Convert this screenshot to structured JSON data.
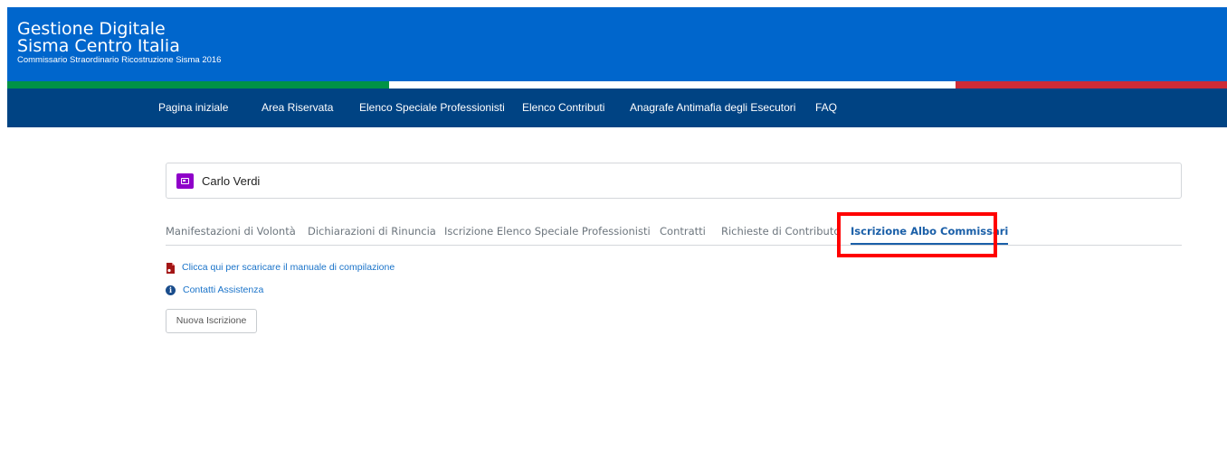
{
  "header": {
    "title_line1": "Gestione Digitale",
    "title_line2": "Sisma Centro Italia",
    "subtitle": "Commissario Straordinario Ricostruzione Sisma 2016",
    "background": "#0066cc"
  },
  "tricolor": {
    "green": "#009246",
    "white": "#ffffff",
    "red": "#ce2b37"
  },
  "nav": {
    "items": [
      {
        "label": "Pagina iniziale"
      },
      {
        "label": "Area Riservata"
      },
      {
        "label": "Elenco Speciale Professionisti"
      },
      {
        "label": "Elenco Contributi"
      },
      {
        "label": "Anagrafe Antimafia degli Esecutori"
      },
      {
        "label": "FAQ"
      }
    ]
  },
  "user": {
    "name": "Carlo Verdi",
    "icon": "id-card-icon",
    "badge_color": "#8f00c9"
  },
  "tabs": [
    {
      "label": "Manifestazioni di Volontà"
    },
    {
      "label": "Dichiarazioni di Rinuncia"
    },
    {
      "label": "Iscrizione Elenco Speciale Professionisti"
    },
    {
      "label": "Contratti"
    },
    {
      "label": "Richieste di Contributo"
    },
    {
      "label": "Iscrizione Albo Commissari",
      "active": true
    }
  ],
  "links": {
    "manual": {
      "label": "Clicca qui per scaricare il manuale di compilazione",
      "icon": "pdf-icon"
    },
    "support": {
      "label": "Contatti Assistenza",
      "icon": "info-icon"
    }
  },
  "actions": {
    "new_registration": "Nuova Iscrizione"
  },
  "annotation": {
    "highlight_color": "#ff0000"
  }
}
